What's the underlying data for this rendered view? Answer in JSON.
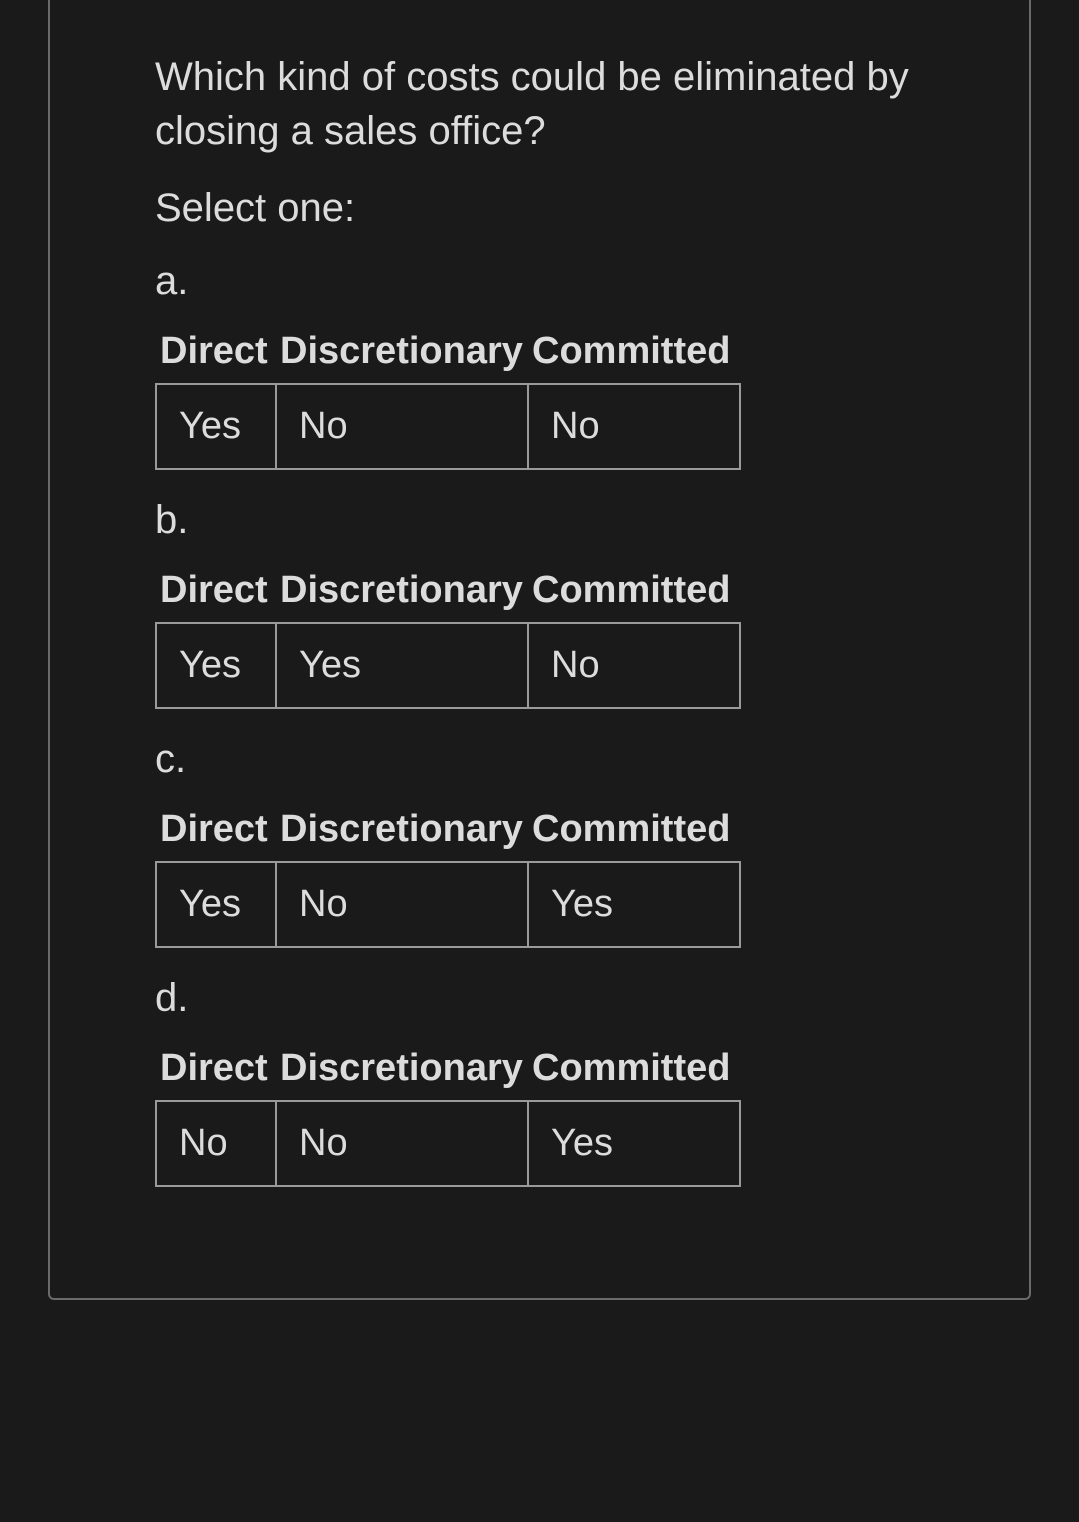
{
  "question": "Which kind of costs could be eliminated by closing a sales office?",
  "select_one_label": "Select one:",
  "headers": {
    "h1": "Direct",
    "h2": "Discretionary",
    "h3": "Committed"
  },
  "options": [
    {
      "label": "a.",
      "cells": {
        "direct": "Yes",
        "discretionary": "No",
        "committed": "No"
      }
    },
    {
      "label": "b.",
      "cells": {
        "direct": "Yes",
        "discretionary": "Yes",
        "committed": "No"
      }
    },
    {
      "label": "c.",
      "cells": {
        "direct": "Yes",
        "discretionary": "No",
        "committed": "Yes"
      }
    },
    {
      "label": "d.",
      "cells": {
        "direct": "No",
        "discretionary": "No",
        "committed": "Yes"
      }
    }
  ]
}
